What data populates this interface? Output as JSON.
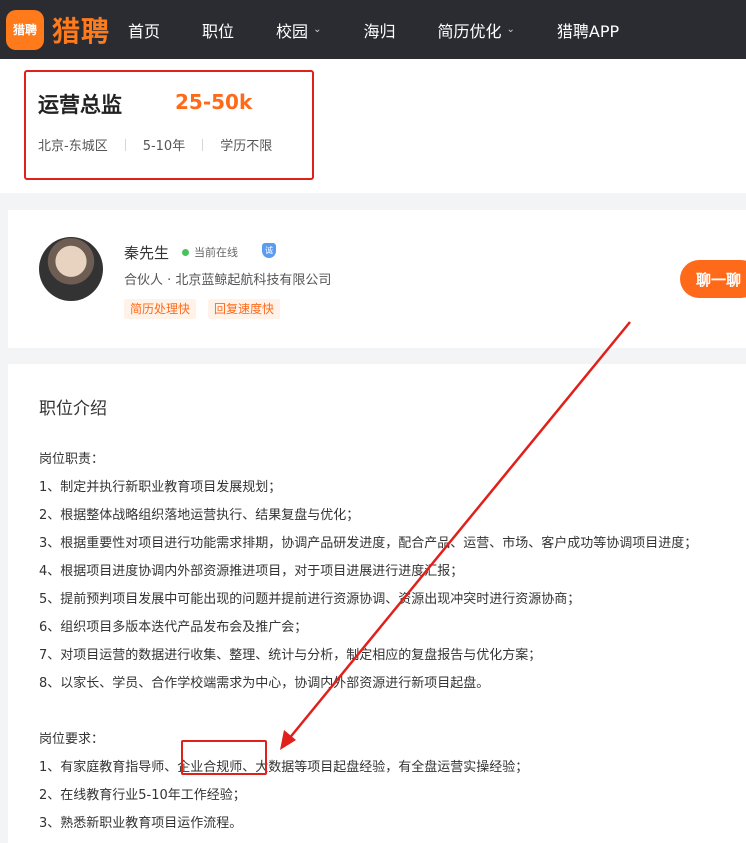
{
  "nav": {
    "logo_mark": "猎聘",
    "logo_text": "猎聘",
    "items": [
      {
        "label": "首页"
      },
      {
        "label": "职位"
      },
      {
        "label": "校园"
      },
      {
        "label": "海归"
      },
      {
        "label": "简历优化"
      },
      {
        "label": "猎聘APP"
      }
    ]
  },
  "job": {
    "title": "运营总监",
    "salary": "25-50k",
    "location": "北京-东城区",
    "experience": "5-10年",
    "education": "学历不限"
  },
  "recruiter": {
    "name": "秦先生",
    "status": "当前在线",
    "verify_badge": "诚",
    "company_line": "合伙人 · 北京蓝鲸起航科技有限公司",
    "tags": [
      "简历处理快",
      "回复速度快"
    ],
    "chat_label": "聊一聊"
  },
  "description": {
    "heading": "职位介绍",
    "duties_heading": "岗位职责：",
    "duties": [
      "1、制定并执行新职业教育项目发展规划；",
      "2、根据整体战略组织落地运营执行、结果复盘与优化；",
      "3、根据重要性对项目进行功能需求排期，协调产品研发进度，配合产品、运营、市场、客户成功等协调项目进度；",
      "4、根据项目进度协调内外部资源推进项目，对于项目进展进行进度汇报；",
      "5、提前预判项目发展中可能出现的问题并提前进行资源协调、资源出现冲突时进行资源协商；",
      "6、组织项目多版本迭代产品发布会及推广会；",
      "7、对项目运营的数据进行收集、整理、统计与分析，制定相应的复盘报告与优化方案；",
      "8、以家长、学员、合作学校端需求为中心，协调内外部资源进行新项目起盘。"
    ],
    "requirements_heading": "岗位要求：",
    "requirements": [
      "1、有家庭教育指导师、企业合规师、大数据等项目起盘经验，有全盘运营实操经验；",
      "2、在线教育行业5-10年工作经验；",
      "3、熟悉新职业教育项目运作流程。"
    ]
  },
  "colors": {
    "nav_bg": "#2b2c31",
    "accent": "#ff6a1a",
    "annotation_red": "#e0201b",
    "online_green": "#49c25b"
  }
}
